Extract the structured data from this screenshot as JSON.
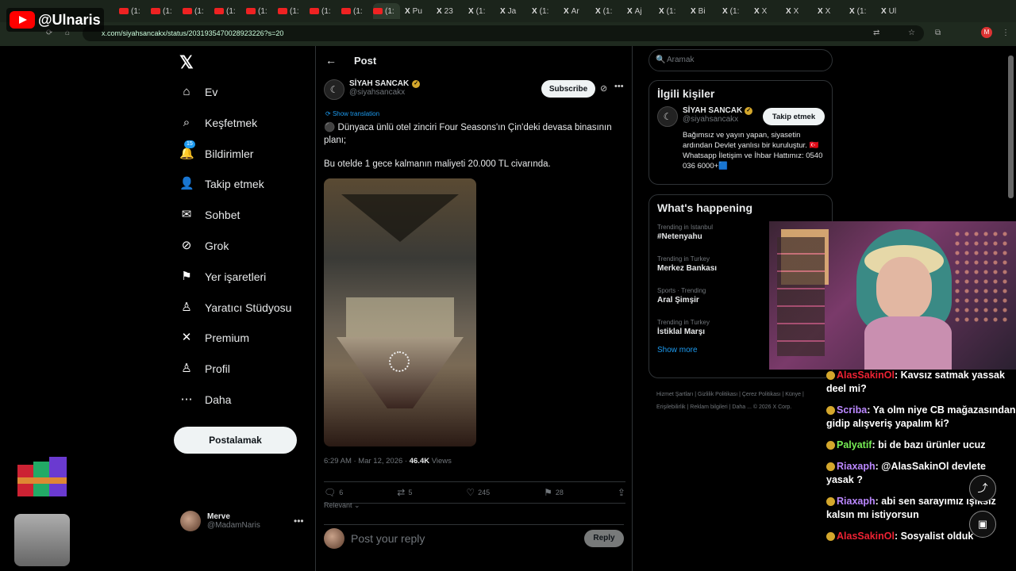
{
  "browser": {
    "url": "x.com/siyahsancakx/status/2031935470028923226?s=20",
    "tabs": [
      "(1:",
      "(1:",
      "(1:",
      "(1:",
      "(1:",
      "(1:",
      "(1:",
      "(1:",
      "(1:",
      "Pu",
      "23",
      "(1:",
      "Ja",
      "(1:",
      "Ar",
      "(1:",
      "Aj",
      "(1:",
      "Bi",
      "(1:",
      "X",
      "X",
      "X",
      "(1:",
      "Ul"
    ],
    "profile_initial": "M"
  },
  "overlay": {
    "channel": "@Ulnaris"
  },
  "nav": {
    "logo": "𝕏",
    "items": [
      {
        "label": "Ev",
        "icon": "home-icon"
      },
      {
        "label": "Keşfetmek",
        "icon": "search-icon"
      },
      {
        "label": "Bildirimler",
        "icon": "bell-icon",
        "badge": "15"
      },
      {
        "label": "Takip etmek",
        "icon": "person-plus-icon"
      },
      {
        "label": "Sohbet",
        "icon": "mail-icon"
      },
      {
        "label": "Grok",
        "icon": "grok-icon"
      },
      {
        "label": "Yer işaretleri",
        "icon": "bookmark-icon"
      },
      {
        "label": "Yaratıcı Stüdyosu",
        "icon": "studio-icon"
      },
      {
        "label": "Premium",
        "icon": "x-icon"
      },
      {
        "label": "Profil",
        "icon": "person-icon"
      },
      {
        "label": "Daha",
        "icon": "more-circle-icon"
      }
    ],
    "post_button": "Postalamak",
    "user": {
      "name": "Merve",
      "handle": "@MadamNaris"
    }
  },
  "post": {
    "header": "Post",
    "author": "SİYAH SANCAK",
    "handle": "@siyahsancakx",
    "subscribe": "Subscribe",
    "translate": "Show translation",
    "text1": "⚫ Dünyaca ünlü otel zinciri Four Seasons'ın Çin'deki devasa binasının planı;",
    "text2": "Bu otelde 1 gece kalmanın maliyeti 20.000 TL civarında.",
    "time": "6:29 AM · Mar 12, 2026 · ",
    "views": "46.4K",
    "views_label": " Views",
    "replies": "6",
    "reposts": "5",
    "likes": "245",
    "bookmarks": "28",
    "relevant": "Relevant",
    "reply_placeholder": "Post your reply",
    "reply_button": "Reply"
  },
  "sidebar": {
    "search_placeholder": "Aramak",
    "related_title": "İlgili kişiler",
    "related": {
      "name": "SİYAH SANCAK",
      "handle": "@siyahsancakx",
      "follow": "Takip etmek",
      "bio": "Bağımsız ve yayın yapan, siyasetin ardından Devlet yanlısı bir kuruluştur. 🇹🇷Whatsapp İletişim ve İhbar Hattımız: 0540 036 6000+🟦"
    },
    "happening_title": "What's happening",
    "trends": [
      {
        "context": "Trending in Istanbul",
        "title": "#Netenyahu"
      },
      {
        "context": "Trending in Turkey",
        "title": "Merkez Bankası"
      },
      {
        "context": "Sports · Trending",
        "title": "Aral Şimşir"
      },
      {
        "context": "Trending in Turkey",
        "title": "İstiklal Marşı"
      }
    ],
    "show_more": "Show more",
    "footer": "Hizmet Şartları  |  Gizlilik Politikası  |  Çerez Politikası  |  Künye  |  Erişilebilirlik  |  Reklam bilgileri  |  Daha ...  © 2026 X Corp."
  },
  "chat": [
    {
      "user": "AlasSakinOl",
      "color": "#e23",
      "text": ": Kavsız satmak yassak deel mi?"
    },
    {
      "user": "Scriba",
      "color": "#b8f",
      "text": ": Ya olm niye CB mağazasından gidip alışveriş yapalım ki?"
    },
    {
      "user": "Palyatif",
      "color": "#7e5",
      "text": ": bi de bazı ürünler ucuz"
    },
    {
      "user": "Riaxaph",
      "color": "#b8f",
      "text": ": @AlasSakinOl devlete yasak ?"
    },
    {
      "user": "Riaxaph",
      "color": "#b8f",
      "text": ": abi sen sarayımız ışıksız kalsın mı istiyorsun"
    },
    {
      "user": "AlasSakinOl",
      "color": "#e23",
      "text": ": Sosyalist olduk"
    }
  ]
}
